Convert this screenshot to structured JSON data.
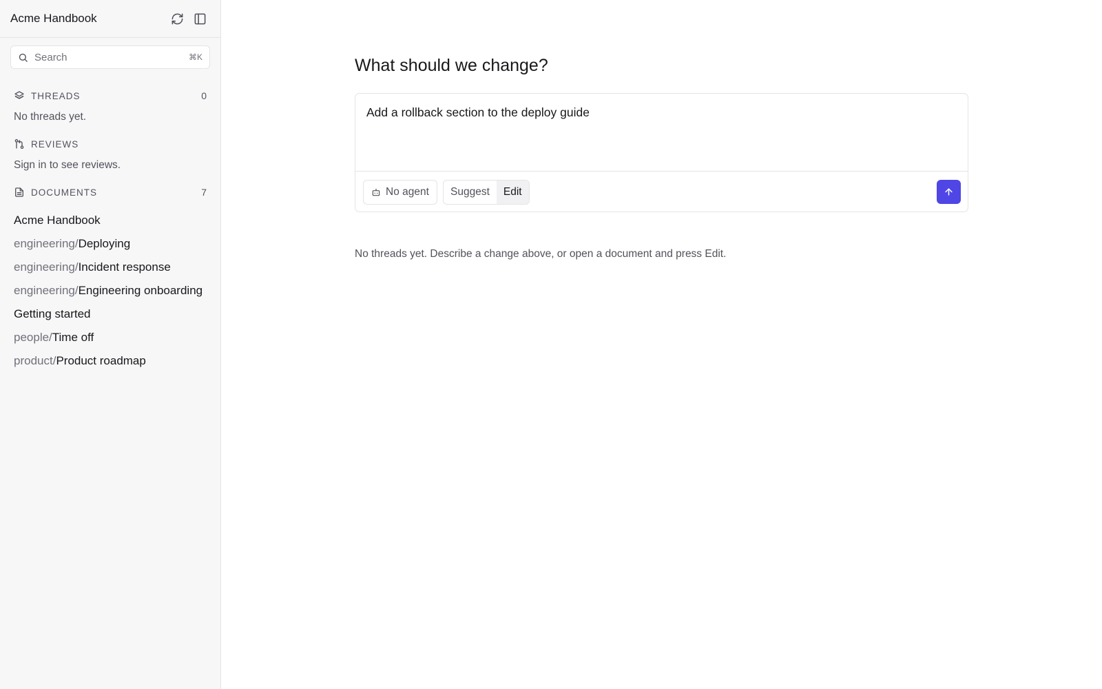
{
  "sidebar": {
    "title": "Acme Handbook",
    "refresh_icon": "refresh-icon",
    "toggle_icon": "sidebar-panel-icon",
    "search": {
      "placeholder": "Search",
      "shortcut": "⌘K"
    },
    "threads": {
      "label": "THREADS",
      "count": "0",
      "empty": "No threads yet.",
      "icon": "layers-icon"
    },
    "reviews": {
      "label": "REVIEWS",
      "empty": "Sign in to see reviews.",
      "icon": "git-pull-request-icon"
    },
    "documents": {
      "label": "DOCUMENTS",
      "count": "7",
      "icon": "file-text-icon",
      "items": [
        {
          "prefix": "",
          "name": "Acme Handbook"
        },
        {
          "prefix": "engineering/",
          "name": "Deploying"
        },
        {
          "prefix": "engineering/",
          "name": "Incident response"
        },
        {
          "prefix": "engineering/",
          "name": "Engineering onboarding"
        },
        {
          "prefix": "",
          "name": "Getting started"
        },
        {
          "prefix": "people/",
          "name": "Time off"
        },
        {
          "prefix": "product/",
          "name": "Product roadmap"
        }
      ]
    }
  },
  "main": {
    "title": "What should we change?",
    "composer": {
      "value": "Add a rollback section to the deploy guide",
      "agent_label": "No agent",
      "agent_icon": "bot-icon",
      "modes": [
        "Suggest",
        "Edit"
      ],
      "active_mode": "Edit",
      "send_icon": "arrow-up-icon"
    },
    "hint": "No threads yet. Describe a change above, or open a document and press Edit."
  },
  "colors": {
    "accent": "#4f46e5",
    "sidebar_bg": "#f7f7f8",
    "border": "#e4e4e7",
    "muted_text": "#71717a"
  }
}
